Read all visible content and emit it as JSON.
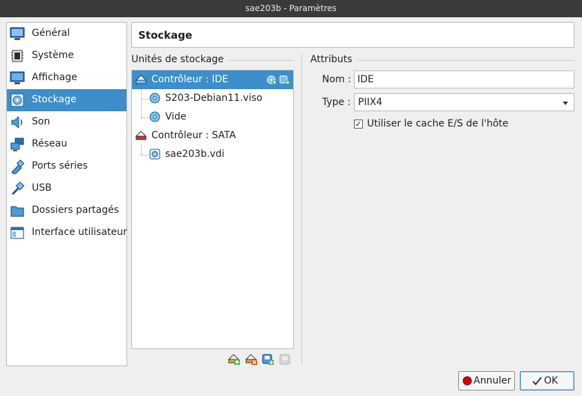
{
  "window": {
    "title": "sae203b - Paramètres"
  },
  "sidebar": {
    "items": [
      {
        "label": "Général",
        "icon": "general-monitor-icon"
      },
      {
        "label": "Système",
        "icon": "chip-icon"
      },
      {
        "label": "Affichage",
        "icon": "display-monitor-icon"
      },
      {
        "label": "Stockage",
        "icon": "disc-storage-icon",
        "selected": true
      },
      {
        "label": "Son",
        "icon": "speaker-icon"
      },
      {
        "label": "Réseau",
        "icon": "network-icon"
      },
      {
        "label": "Ports séries",
        "icon": "serial-port-icon"
      },
      {
        "label": "USB",
        "icon": "usb-icon"
      },
      {
        "label": "Dossiers partagés",
        "icon": "folder-icon"
      },
      {
        "label": "Interface utilisateur",
        "icon": "ui-window-icon"
      }
    ]
  },
  "header": {
    "title": "Stockage"
  },
  "storage": {
    "group_title": "Unités de stockage",
    "tree": [
      {
        "label": "Contrôleur : IDE",
        "icon": "ide-controller-icon",
        "selected": true
      },
      {
        "label": "S203-Debian11.viso",
        "icon": "optical-disc-icon"
      },
      {
        "label": "Vide",
        "icon": "optical-disc-icon"
      },
      {
        "label": "Contrôleur : SATA",
        "icon": "sata-controller-icon"
      },
      {
        "label": "sae203b.vdi",
        "icon": "hard-disk-icon"
      }
    ],
    "toolbar": {
      "add_controller": "add-controller-icon",
      "remove_controller": "remove-controller-icon",
      "add_attachment": "add-attachment-icon",
      "remove_attachment": "remove-attachment-icon"
    }
  },
  "attributes": {
    "group_title": "Attributs",
    "name_label": "Nom :",
    "name_value": "IDE",
    "type_label": "Type :",
    "type_value": "PIIX4",
    "cache_label": "Utiliser le cache E/S de l'hôte",
    "cache_checked": true
  },
  "buttons": {
    "cancel": "Annuler",
    "ok": "OK"
  },
  "colors": {
    "selection": "#3d8ec9",
    "background": "#efefef"
  }
}
